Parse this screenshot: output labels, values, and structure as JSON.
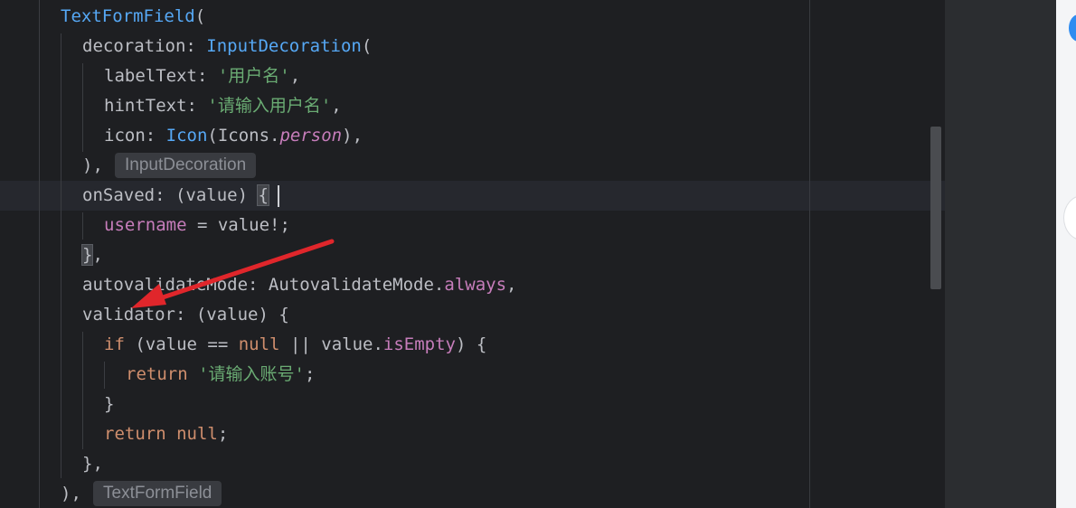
{
  "code": {
    "line_1": {
      "cls": "TextFormField",
      "paren": "("
    },
    "line_2": {
      "key": "decoration: ",
      "cls": "InputDecoration",
      "paren": "("
    },
    "line_3": {
      "key": "labelText: ",
      "str": "'用户名'",
      "tail": ","
    },
    "line_4": {
      "key": "hintText: ",
      "str": "'请输入用户名'",
      "tail": ","
    },
    "line_5": {
      "key": "icon: ",
      "cls": "Icon",
      "open": "(Icons.",
      "ital": "person",
      "tail": "),"
    },
    "line_6": {
      "text": "),",
      "hint": "InputDecoration"
    },
    "line_7": {
      "key": "onSaved: (value) ",
      "brace": "{"
    },
    "line_8": {
      "field": "username",
      "rest": " = value!;"
    },
    "line_9": {
      "brace": "}",
      "tail": ","
    },
    "line_10": {
      "key": "autovalidateMode: AutovalidateMode.",
      "field": "always",
      "tail": ","
    },
    "line_11": {
      "text": "validator: (value) {"
    },
    "line_12": {
      "kw1": "if",
      "mid1": " (value == ",
      "kw2": "null",
      "mid2": " || value.",
      "field": "isEmpty",
      "tail": ") {"
    },
    "line_13": {
      "kw": "return",
      "sp": " ",
      "str": "'请输入账号'",
      "tail": ";"
    },
    "line_14": {
      "text": "}"
    },
    "line_15": {
      "kw1": "return",
      "sp": " ",
      "kw2": "null",
      "tail": ";"
    },
    "line_16": {
      "text": "},"
    },
    "line_17": {
      "text": "),",
      "hint": "TextFormField"
    }
  },
  "colors": {
    "background": "#1e1f22",
    "class": "#56a8f5",
    "string": "#6aab73",
    "keyword": "#cf8e6d",
    "field": "#c77dbb",
    "annotation_arrow": "#e0262b"
  }
}
